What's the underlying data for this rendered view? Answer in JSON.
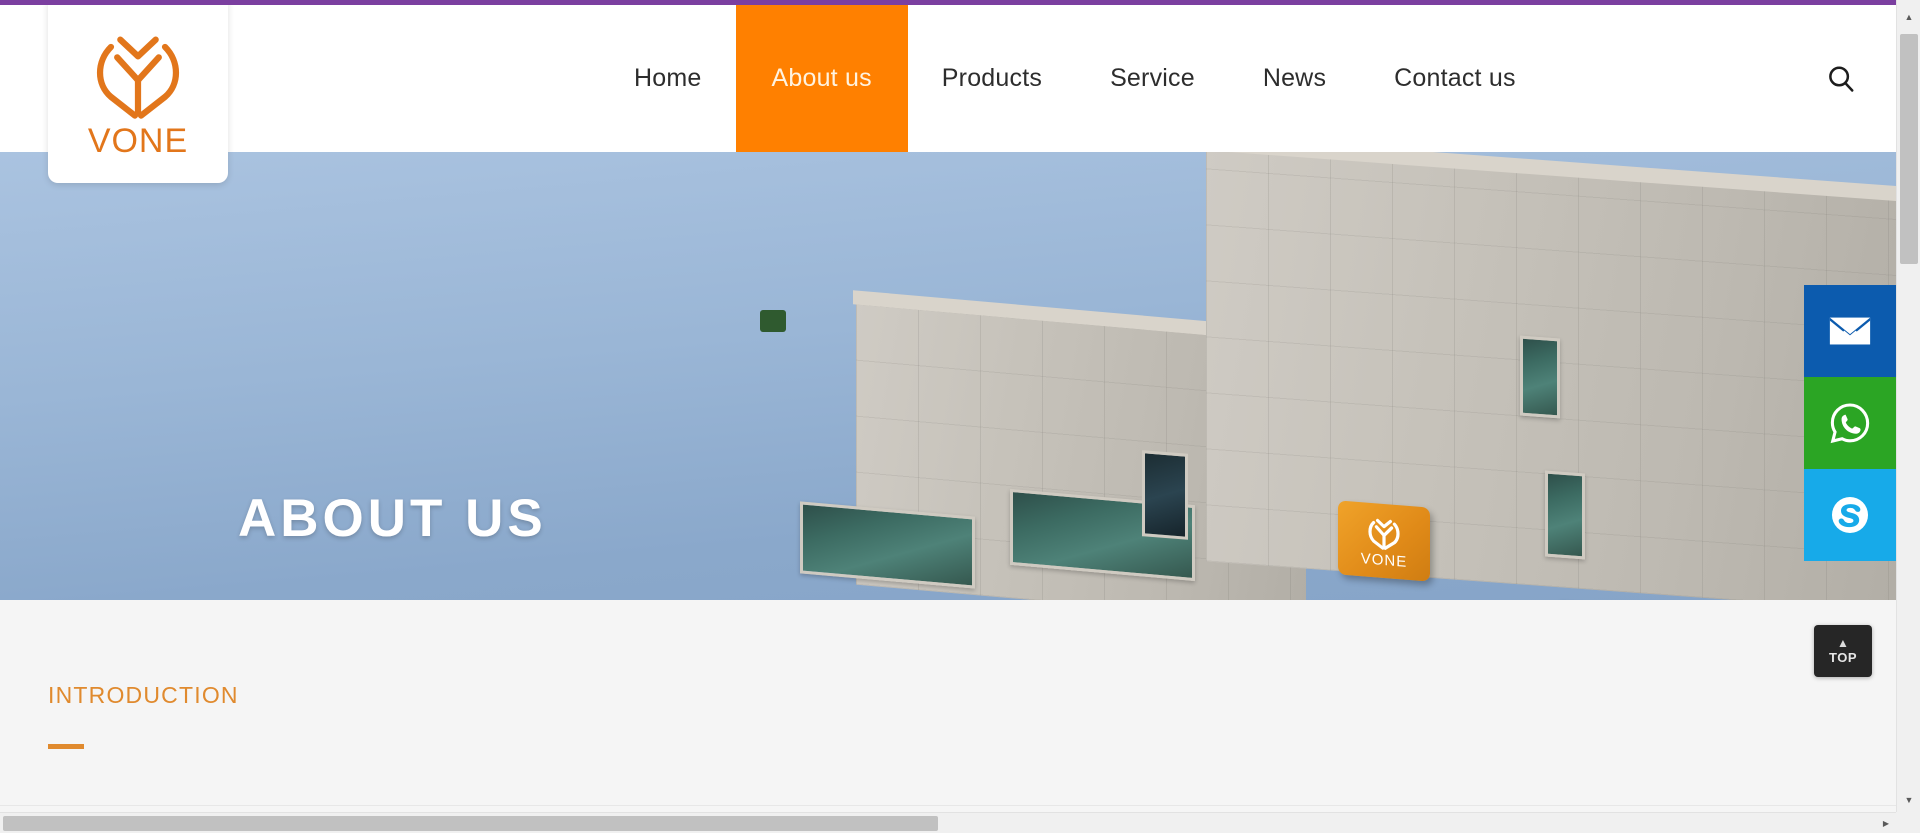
{
  "browser": {
    "accent_color": "#7B3FA0",
    "vertical_scrollbar": "vertical-scrollbar",
    "horizontal_scrollbar": "horizontal-scrollbar",
    "scroll_up_glyph": "▲",
    "scroll_down_glyph": "▼",
    "scroll_left_glyph": "◀",
    "scroll_right_glyph": "▶"
  },
  "brand": {
    "name": "VONE",
    "logo_color": "#E2761B",
    "logo_icon": "vone-leaf-logo"
  },
  "header": {
    "background": "#FFFFFF",
    "active_color": "#FF8000",
    "nav": [
      {
        "label": "Home",
        "active": false
      },
      {
        "label": "About us",
        "active": true
      },
      {
        "label": "Products",
        "active": false
      },
      {
        "label": "Service",
        "active": false
      },
      {
        "label": "News",
        "active": false
      },
      {
        "label": "Contact us",
        "active": false
      }
    ],
    "search_icon": "search-icon"
  },
  "hero": {
    "title": "ABOUT US",
    "title_color": "#FFFFFF",
    "image_description": "company-building-photo",
    "building_sign_text": "VONE"
  },
  "main": {
    "section_title": "INTRODUCTION",
    "section_title_color": "#E08A2E",
    "background": "#F5F5F5"
  },
  "floating": {
    "social": [
      {
        "name": "email",
        "icon": "envelope-icon",
        "color": "#0C5BAE"
      },
      {
        "name": "whatsapp",
        "icon": "whatsapp-icon",
        "color": "#2BA524"
      },
      {
        "name": "skype",
        "icon": "skype-icon",
        "color": "#17AAE9"
      }
    ],
    "back_to_top": {
      "label": "TOP",
      "chevron": "▲",
      "color": "#262626"
    }
  }
}
